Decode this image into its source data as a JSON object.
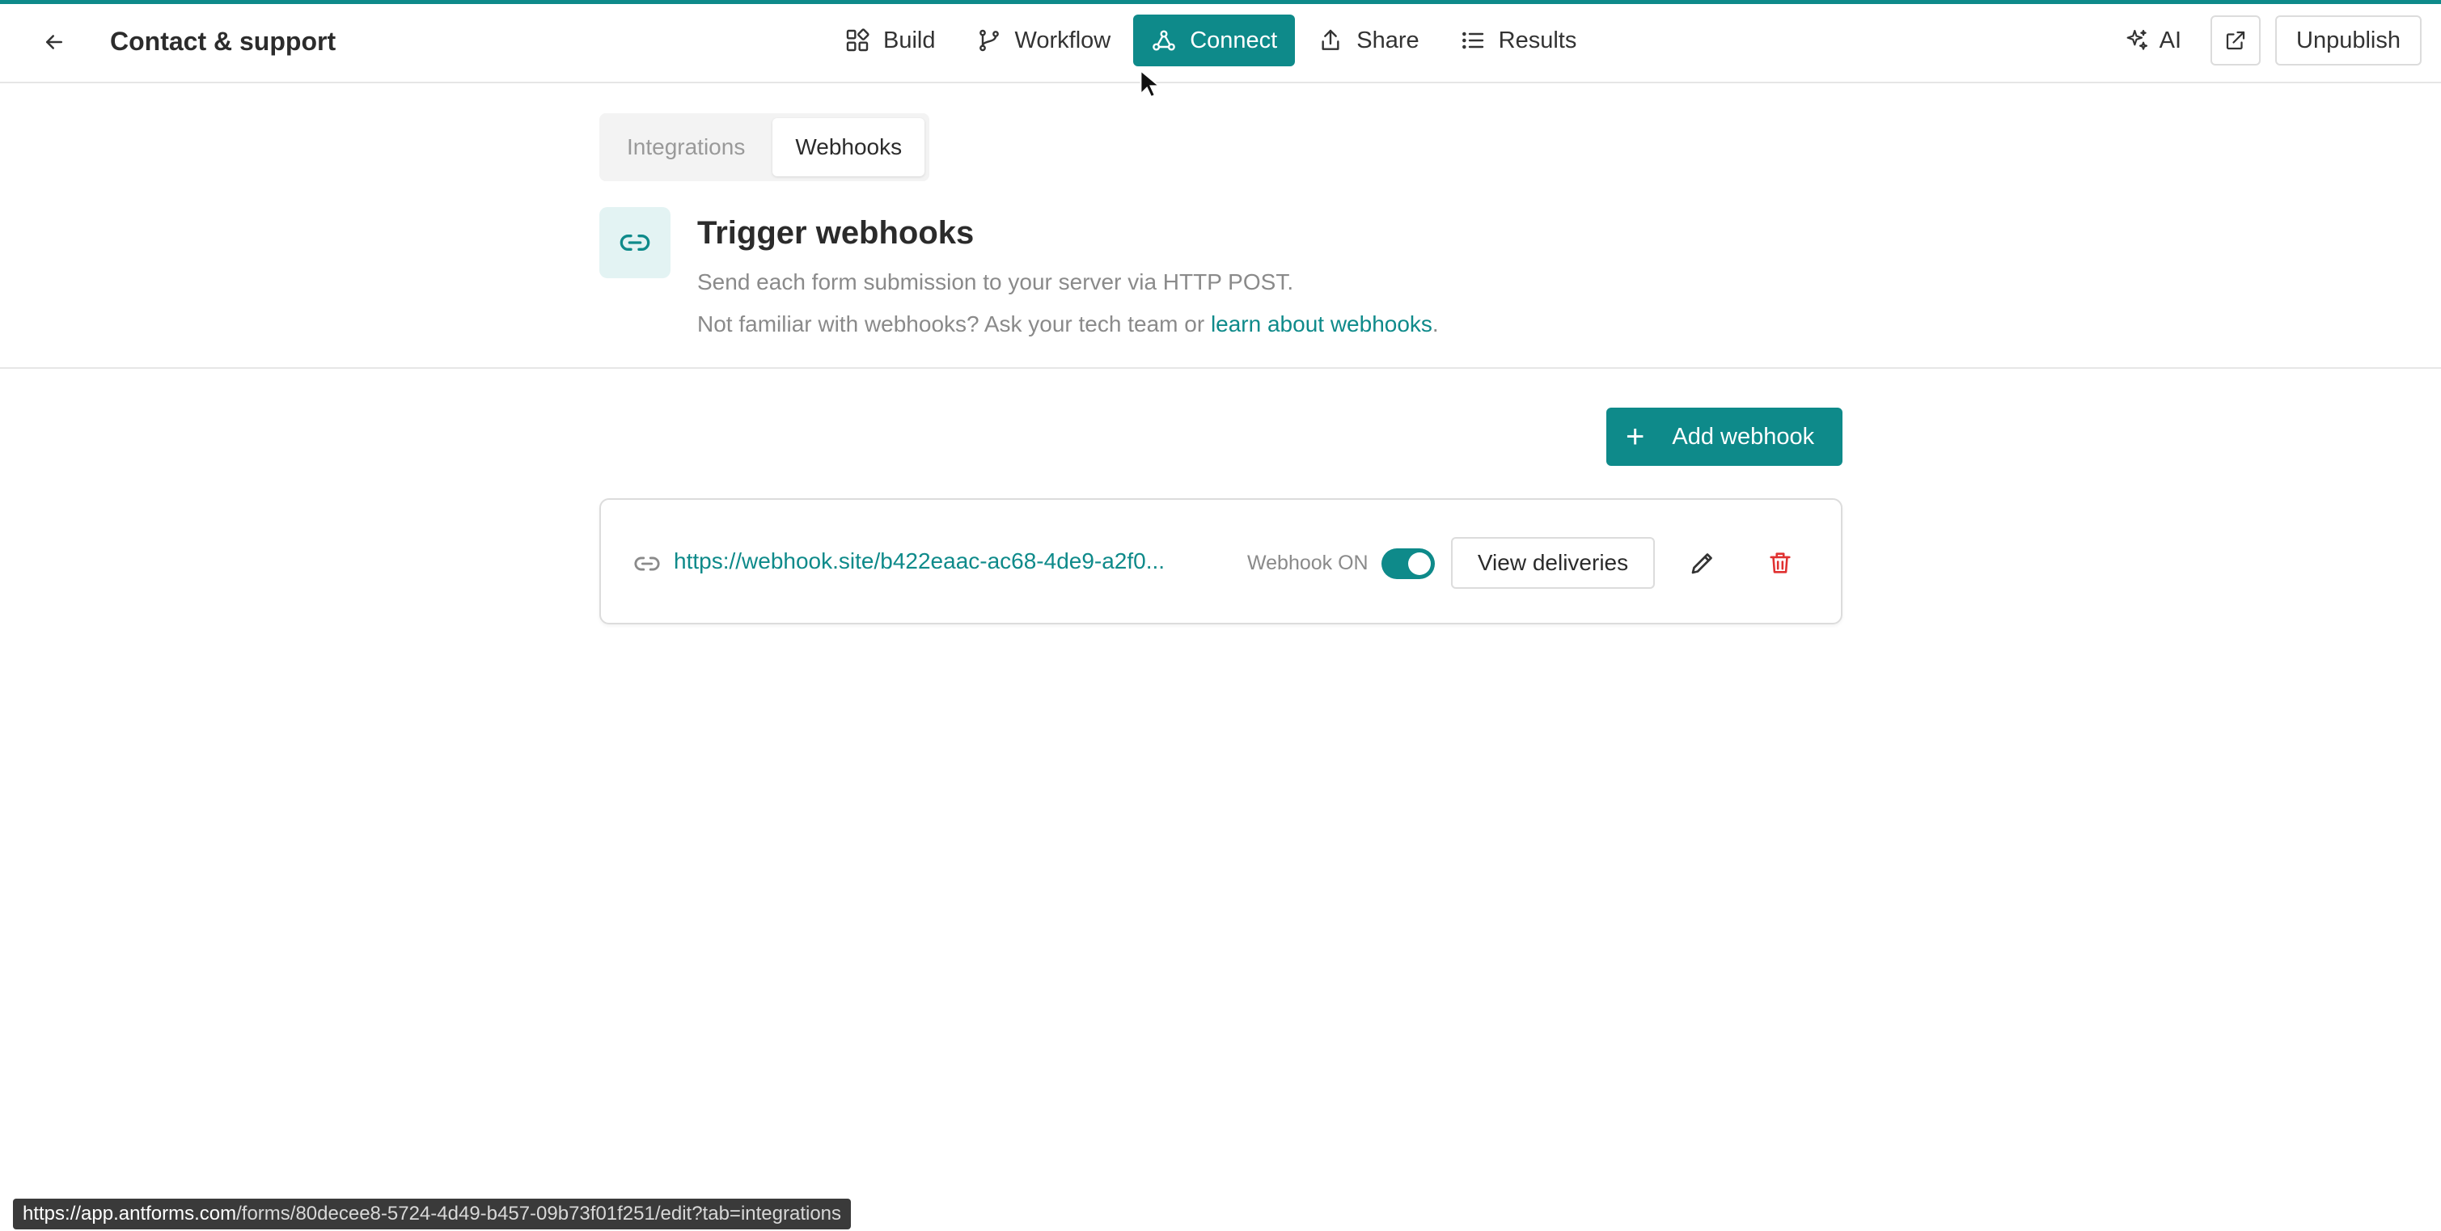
{
  "header": {
    "title": "Contact & support",
    "nav": [
      {
        "label": "Build",
        "icon": "build-icon"
      },
      {
        "label": "Workflow",
        "icon": "workflow-icon"
      },
      {
        "label": "Connect",
        "icon": "connect-icon",
        "active": true
      },
      {
        "label": "Share",
        "icon": "share-icon"
      },
      {
        "label": "Results",
        "icon": "results-icon"
      }
    ],
    "ai_label": "AI",
    "unpublish_label": "Unpublish"
  },
  "tabs": {
    "integrations": "Integrations",
    "webhooks": "Webhooks",
    "selected": "Webhooks"
  },
  "section": {
    "title": "Trigger webhooks",
    "description": "Send each form submission to your server via HTTP POST.",
    "help_prefix": "Not familiar with webhooks? Ask your tech team or ",
    "help_link": "learn about webhooks",
    "help_suffix": "."
  },
  "actions": {
    "add_webhook": "Add webhook"
  },
  "webhook": {
    "url": "https://webhook.site/b422eaac-ac68-4de9-a2f0...",
    "status_label": "Webhook ON",
    "enabled": true,
    "view_deliveries": "View deliveries"
  },
  "statusbar": {
    "host": "https://app.antforms.com",
    "path": "/forms/80decee8-5724-4d49-b457-09b73f01f251/edit?tab=integrations"
  },
  "colors": {
    "accent": "#0e8a8a",
    "danger": "#e03131"
  }
}
